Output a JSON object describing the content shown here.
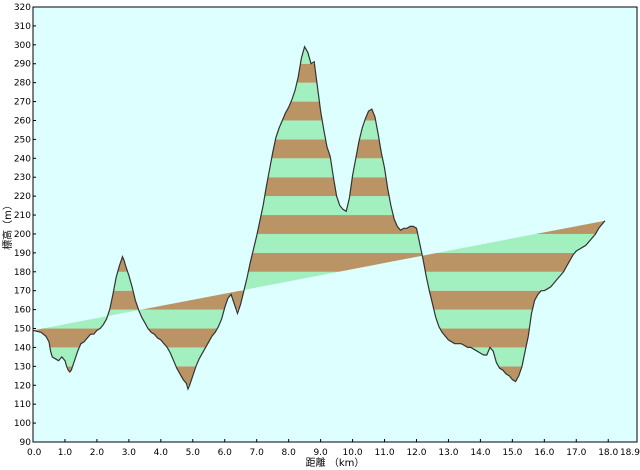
{
  "chart_data": {
    "type": "area",
    "title": "",
    "xlabel": "距離 （km）",
    "ylabel": "標高（m）",
    "xlim": [
      0.0,
      18.9
    ],
    "ylim": [
      90,
      320
    ],
    "x_ticks": [
      "0.0",
      "1.0",
      "2.0",
      "3.0",
      "4.0",
      "5.0",
      "6.0",
      "7.0",
      "8.0",
      "9.0",
      "10.0",
      "11.0",
      "12.0",
      "13.0",
      "14.0",
      "15.0",
      "16.0",
      "17.0",
      "18.0",
      "18.9"
    ],
    "x_tick_values": [
      0,
      1,
      2,
      3,
      4,
      5,
      6,
      7,
      8,
      9,
      10,
      11,
      12,
      13,
      14,
      15,
      16,
      17,
      18,
      18.9
    ],
    "y_ticks": [
      90,
      100,
      110,
      120,
      130,
      140,
      150,
      160,
      170,
      180,
      190,
      200,
      210,
      220,
      230,
      240,
      250,
      260,
      270,
      280,
      290,
      300,
      310,
      320
    ],
    "grid": false,
    "colors": {
      "background": "#ddffff",
      "band_a": "#bb9466",
      "band_b": "#a2f0c0",
      "line": "#333333"
    },
    "band_height_m": 10,
    "series": [
      {
        "values_x": [
          0.0,
          0.25,
          0.4,
          0.5,
          0.55,
          0.6,
          0.7,
          0.8,
          0.9,
          1.0,
          1.05,
          1.1,
          1.15,
          1.2,
          1.3,
          1.4,
          1.5,
          1.6,
          1.7,
          1.8,
          1.9,
          2.0,
          2.1,
          2.2,
          2.3,
          2.4,
          2.5,
          2.6,
          2.7,
          2.8,
          2.85,
          2.9,
          3.0,
          3.1,
          3.2,
          3.3,
          3.4,
          3.5,
          3.6,
          3.7,
          3.8,
          3.9,
          4.0,
          4.1,
          4.2,
          4.3,
          4.4,
          4.5,
          4.6,
          4.7,
          4.8,
          4.85,
          4.9,
          5.0,
          5.1,
          5.2,
          5.3,
          5.4,
          5.5,
          5.6,
          5.7,
          5.8,
          5.9,
          6.0,
          6.1,
          6.2,
          6.3,
          6.4,
          6.5,
          6.6,
          6.7,
          6.8,
          6.9,
          7.0,
          7.1,
          7.2,
          7.3,
          7.4,
          7.5,
          7.6,
          7.7,
          7.8,
          7.9,
          8.0,
          8.1,
          8.2,
          8.3,
          8.4,
          8.5,
          8.6,
          8.7,
          8.8,
          8.9,
          9.0,
          9.1,
          9.2,
          9.3,
          9.4,
          9.5,
          9.6,
          9.7,
          9.8,
          9.9,
          10.0,
          10.1,
          10.2,
          10.3,
          10.4,
          10.5,
          10.6,
          10.7,
          10.8,
          10.9,
          11.0,
          11.1,
          11.2,
          11.3,
          11.4,
          11.5,
          11.6,
          11.7,
          11.8,
          11.9,
          12.0,
          12.1,
          12.2,
          12.3,
          12.4,
          12.5,
          12.6,
          12.7,
          12.8,
          12.9,
          13.0,
          13.1,
          13.2,
          13.3,
          13.4,
          13.5,
          13.6,
          13.7,
          13.8,
          13.9,
          14.0,
          14.1,
          14.2,
          14.3,
          14.4,
          14.5,
          14.6,
          14.7,
          14.8,
          14.9,
          15.0,
          15.1,
          15.2,
          15.3,
          15.4,
          15.5,
          15.6,
          15.7,
          15.8,
          15.9,
          16.0,
          16.1,
          16.2,
          16.3,
          16.4,
          16.5,
          16.6,
          16.7,
          16.8,
          16.9,
          17.0,
          17.1,
          17.2,
          17.3,
          17.4,
          17.5,
          17.6,
          17.7,
          17.8,
          17.9,
          18.0,
          18.1,
          18.2,
          18.3,
          18.4,
          18.5,
          18.6,
          18.7,
          18.8,
          18.9
        ],
        "values_y": [
          149,
          148,
          146,
          143,
          138,
          135,
          134,
          133,
          135,
          133,
          130,
          128,
          127,
          128,
          133,
          138,
          142,
          143,
          145,
          147,
          147,
          149,
          150,
          152,
          155,
          160,
          168,
          177,
          183,
          188,
          186,
          183,
          178,
          172,
          165,
          160,
          156,
          153,
          150,
          148,
          147,
          145,
          144,
          142,
          140,
          137,
          133,
          129,
          126,
          123,
          121,
          118,
          120,
          125,
          130,
          134,
          137,
          140,
          143,
          146,
          148,
          151,
          155,
          161,
          166,
          168,
          163,
          158,
          163,
          170,
          177,
          185,
          192,
          199,
          207,
          215,
          225,
          234,
          243,
          251,
          256,
          260,
          264,
          267,
          271,
          276,
          283,
          293,
          299,
          296,
          290,
          291,
          278,
          265,
          255,
          246,
          241,
          230,
          220,
          215,
          213,
          212,
          219,
          231,
          240,
          249,
          256,
          261,
          265,
          266,
          262,
          253,
          243,
          235,
          224,
          215,
          208,
          204,
          202,
          203,
          203,
          204,
          204,
          203,
          195,
          187,
          178,
          170,
          163,
          156,
          151,
          148,
          146,
          144,
          143,
          142,
          142,
          142,
          141,
          140,
          140,
          139,
          138,
          137,
          136,
          136,
          140,
          138,
          132,
          129,
          128,
          126,
          125,
          123,
          122,
          125,
          130,
          138,
          146,
          158,
          165,
          168,
          170,
          170,
          171,
          172,
          174,
          176,
          178,
          180,
          183,
          186,
          189,
          191,
          192,
          193,
          194,
          196,
          198,
          200,
          203,
          205,
          207
        ],
        "values_desc": "elevation (m) vs distance (km)"
      }
    ]
  }
}
